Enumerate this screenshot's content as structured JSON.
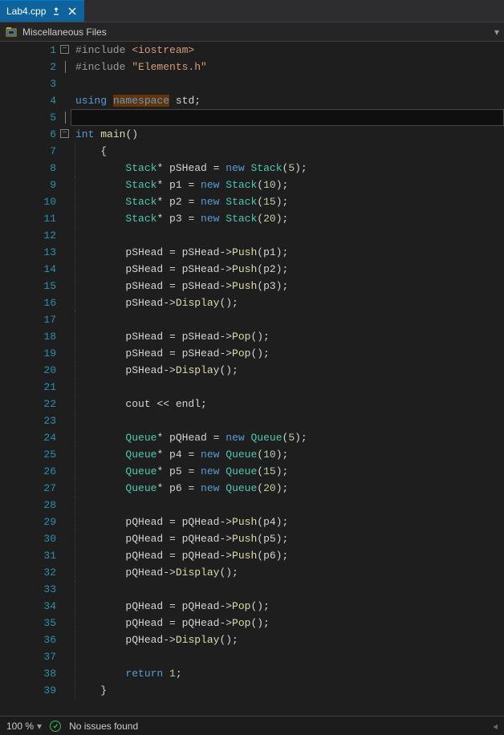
{
  "tab": {
    "filename": "Lab4.cpp"
  },
  "context": {
    "scope": "Miscellaneous Files"
  },
  "status": {
    "zoom": "100 %",
    "issues": "No issues found"
  },
  "code": {
    "lines": [
      {
        "n": 1,
        "indent": 0,
        "fold": true,
        "tokens": [
          [
            "include-kw",
            "#include "
          ],
          [
            "str",
            "<iostream>"
          ]
        ]
      },
      {
        "n": 2,
        "indent": 0,
        "fold": false,
        "bar": true,
        "tokens": [
          [
            "include-kw",
            "#include "
          ],
          [
            "str",
            "\"Elements.h\""
          ]
        ]
      },
      {
        "n": 3,
        "indent": 0,
        "tokens": []
      },
      {
        "n": 4,
        "indent": 0,
        "tokens": [
          [
            "kw",
            "using"
          ],
          [
            "plain",
            " "
          ],
          [
            "kw",
            "namespace"
          ],
          [
            "plain",
            " "
          ],
          [
            "plain",
            "std"
          ],
          [
            "plain",
            ";"
          ]
        ],
        "nsBox": true
      },
      {
        "n": 5,
        "indent": 0,
        "current": true,
        "bar": true,
        "tokens": []
      },
      {
        "n": 6,
        "indent": 0,
        "fold": true,
        "tokens": [
          [
            "kw",
            "int"
          ],
          [
            "plain",
            " "
          ],
          [
            "func",
            "main"
          ],
          [
            "plain",
            "()"
          ]
        ]
      },
      {
        "n": 7,
        "indent": 1,
        "tokens": [
          [
            "plain",
            "{"
          ]
        ]
      },
      {
        "n": 8,
        "indent": 2,
        "tokens": [
          [
            "type",
            "Stack"
          ],
          [
            "plain",
            "* pSHead = "
          ],
          [
            "kw",
            "new"
          ],
          [
            "plain",
            " "
          ],
          [
            "type",
            "Stack"
          ],
          [
            "plain",
            "("
          ],
          [
            "num",
            "5"
          ],
          [
            "plain",
            ");"
          ]
        ]
      },
      {
        "n": 9,
        "indent": 2,
        "tokens": [
          [
            "type",
            "Stack"
          ],
          [
            "plain",
            "* p1 = "
          ],
          [
            "kw",
            "new"
          ],
          [
            "plain",
            " "
          ],
          [
            "type",
            "Stack"
          ],
          [
            "plain",
            "("
          ],
          [
            "num",
            "10"
          ],
          [
            "plain",
            ");"
          ]
        ]
      },
      {
        "n": 10,
        "indent": 2,
        "tokens": [
          [
            "type",
            "Stack"
          ],
          [
            "plain",
            "* p2 = "
          ],
          [
            "kw",
            "new"
          ],
          [
            "plain",
            " "
          ],
          [
            "type",
            "Stack"
          ],
          [
            "plain",
            "("
          ],
          [
            "num",
            "15"
          ],
          [
            "plain",
            ");"
          ]
        ]
      },
      {
        "n": 11,
        "indent": 2,
        "tokens": [
          [
            "type",
            "Stack"
          ],
          [
            "plain",
            "* p3 = "
          ],
          [
            "kw",
            "new"
          ],
          [
            "plain",
            " "
          ],
          [
            "type",
            "Stack"
          ],
          [
            "plain",
            "("
          ],
          [
            "num",
            "20"
          ],
          [
            "plain",
            ");"
          ]
        ]
      },
      {
        "n": 12,
        "indent": 2,
        "tokens": []
      },
      {
        "n": 13,
        "indent": 2,
        "tokens": [
          [
            "plain",
            "pSHead = pSHead->"
          ],
          [
            "func",
            "Push"
          ],
          [
            "plain",
            "(p1);"
          ]
        ]
      },
      {
        "n": 14,
        "indent": 2,
        "tokens": [
          [
            "plain",
            "pSHead = pSHead->"
          ],
          [
            "func",
            "Push"
          ],
          [
            "plain",
            "(p2);"
          ]
        ]
      },
      {
        "n": 15,
        "indent": 2,
        "tokens": [
          [
            "plain",
            "pSHead = pSHead->"
          ],
          [
            "func",
            "Push"
          ],
          [
            "plain",
            "(p3);"
          ]
        ]
      },
      {
        "n": 16,
        "indent": 2,
        "tokens": [
          [
            "plain",
            "pSHead->"
          ],
          [
            "func",
            "Display"
          ],
          [
            "plain",
            "();"
          ]
        ]
      },
      {
        "n": 17,
        "indent": 2,
        "tokens": []
      },
      {
        "n": 18,
        "indent": 2,
        "tokens": [
          [
            "plain",
            "pSHead = pSHead->"
          ],
          [
            "func",
            "Pop"
          ],
          [
            "plain",
            "();"
          ]
        ]
      },
      {
        "n": 19,
        "indent": 2,
        "tokens": [
          [
            "plain",
            "pSHead = pSHead->"
          ],
          [
            "func",
            "Pop"
          ],
          [
            "plain",
            "();"
          ]
        ]
      },
      {
        "n": 20,
        "indent": 2,
        "tokens": [
          [
            "plain",
            "pSHead->"
          ],
          [
            "func",
            "Display"
          ],
          [
            "plain",
            "();"
          ]
        ]
      },
      {
        "n": 21,
        "indent": 2,
        "tokens": []
      },
      {
        "n": 22,
        "indent": 2,
        "tokens": [
          [
            "plain",
            "cout << endl;"
          ]
        ]
      },
      {
        "n": 23,
        "indent": 2,
        "tokens": []
      },
      {
        "n": 24,
        "indent": 2,
        "tokens": [
          [
            "type",
            "Queue"
          ],
          [
            "plain",
            "* pQHead = "
          ],
          [
            "kw",
            "new"
          ],
          [
            "plain",
            " "
          ],
          [
            "type",
            "Queue"
          ],
          [
            "plain",
            "("
          ],
          [
            "num",
            "5"
          ],
          [
            "plain",
            ");"
          ]
        ]
      },
      {
        "n": 25,
        "indent": 2,
        "tokens": [
          [
            "type",
            "Queue"
          ],
          [
            "plain",
            "* p4 = "
          ],
          [
            "kw",
            "new"
          ],
          [
            "plain",
            " "
          ],
          [
            "type",
            "Queue"
          ],
          [
            "plain",
            "("
          ],
          [
            "num",
            "10"
          ],
          [
            "plain",
            ");"
          ]
        ]
      },
      {
        "n": 26,
        "indent": 2,
        "tokens": [
          [
            "type",
            "Queue"
          ],
          [
            "plain",
            "* p5 = "
          ],
          [
            "kw",
            "new"
          ],
          [
            "plain",
            " "
          ],
          [
            "type",
            "Queue"
          ],
          [
            "plain",
            "("
          ],
          [
            "num",
            "15"
          ],
          [
            "plain",
            ");"
          ]
        ]
      },
      {
        "n": 27,
        "indent": 2,
        "tokens": [
          [
            "type",
            "Queue"
          ],
          [
            "plain",
            "* p6 = "
          ],
          [
            "kw",
            "new"
          ],
          [
            "plain",
            " "
          ],
          [
            "type",
            "Queue"
          ],
          [
            "plain",
            "("
          ],
          [
            "num",
            "20"
          ],
          [
            "plain",
            ");"
          ]
        ]
      },
      {
        "n": 28,
        "indent": 2,
        "tokens": []
      },
      {
        "n": 29,
        "indent": 2,
        "tokens": [
          [
            "plain",
            "pQHead = pQHead->"
          ],
          [
            "func",
            "Push"
          ],
          [
            "plain",
            "(p4);"
          ]
        ]
      },
      {
        "n": 30,
        "indent": 2,
        "tokens": [
          [
            "plain",
            "pQHead = pQHead->"
          ],
          [
            "func",
            "Push"
          ],
          [
            "plain",
            "(p5);"
          ]
        ]
      },
      {
        "n": 31,
        "indent": 2,
        "tokens": [
          [
            "plain",
            "pQHead = pQHead->"
          ],
          [
            "func",
            "Push"
          ],
          [
            "plain",
            "(p6);"
          ]
        ]
      },
      {
        "n": 32,
        "indent": 2,
        "tokens": [
          [
            "plain",
            "pQHead->"
          ],
          [
            "func",
            "Display"
          ],
          [
            "plain",
            "();"
          ]
        ]
      },
      {
        "n": 33,
        "indent": 2,
        "tokens": []
      },
      {
        "n": 34,
        "indent": 2,
        "tokens": [
          [
            "plain",
            "pQHead = pQHead->"
          ],
          [
            "func",
            "Pop"
          ],
          [
            "plain",
            "();"
          ]
        ]
      },
      {
        "n": 35,
        "indent": 2,
        "tokens": [
          [
            "plain",
            "pQHead = pQHead->"
          ],
          [
            "func",
            "Pop"
          ],
          [
            "plain",
            "();"
          ]
        ]
      },
      {
        "n": 36,
        "indent": 2,
        "tokens": [
          [
            "plain",
            "pQHead->"
          ],
          [
            "func",
            "Display"
          ],
          [
            "plain",
            "();"
          ]
        ]
      },
      {
        "n": 37,
        "indent": 2,
        "tokens": []
      },
      {
        "n": 38,
        "indent": 2,
        "tokens": [
          [
            "kw",
            "return"
          ],
          [
            "plain",
            " "
          ],
          [
            "num",
            "1"
          ],
          [
            "plain",
            ";"
          ]
        ]
      },
      {
        "n": 39,
        "indent": 1,
        "tokens": [
          [
            "plain",
            "}"
          ]
        ]
      }
    ]
  }
}
